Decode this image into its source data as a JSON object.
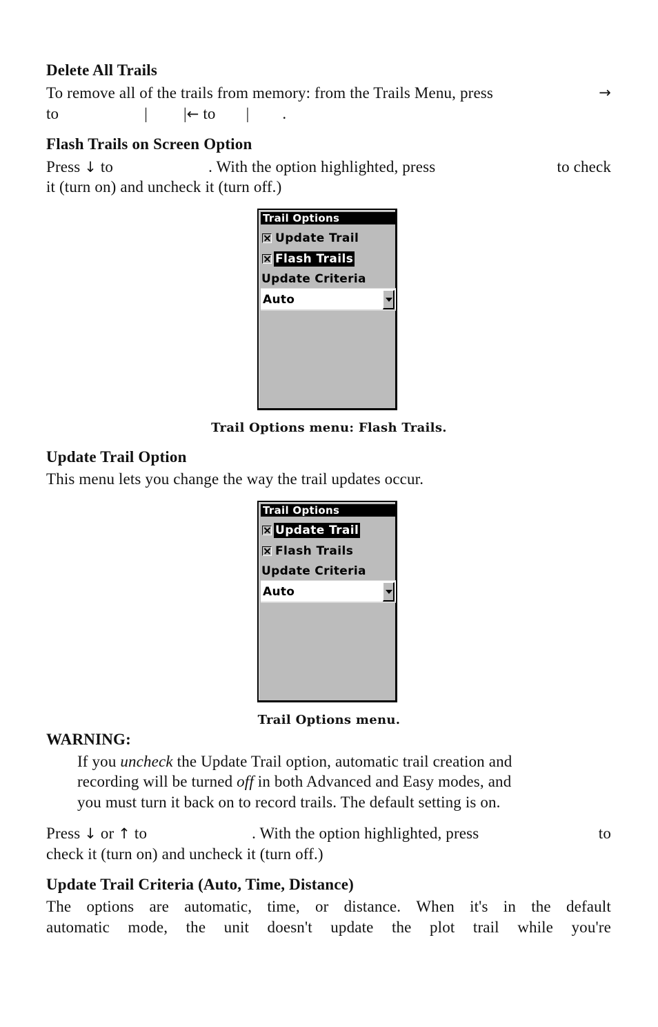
{
  "sections": {
    "delete_all": {
      "heading": "Delete All Trails",
      "line1": "To remove all of the trails from memory: from the Trails Menu, press",
      "line1_arrow": "→",
      "line2_a": "to",
      "line2_sep1": "|",
      "line2_sep2": "|",
      "line2_arrow": "←",
      "line2_b": "to",
      "line2_sep3": "|",
      "line2_end": "."
    },
    "flash_trails": {
      "heading": "Flash Trails on Screen Option",
      "line1_a": "Press",
      "line1_arrow": "↓",
      "line1_b": "to",
      "line1_c": ". With the option highlighted, press",
      "line1_d": "to check",
      "line2": "it (turn on) and uncheck it (turn off.)",
      "caption": "Trail Options menu: Flash Trails."
    },
    "update_trail": {
      "heading": "Update Trail Option",
      "line1": "This menu lets you change the way the trail updates occur.",
      "caption": "Trail Options menu."
    },
    "warning": {
      "label": "WARNING:",
      "line1_a": "If you",
      "line1_em": "uncheck",
      "line1_b": "the Update Trail option, automatic trail creation and",
      "line2_a": "recording will be turned",
      "line2_em": "off",
      "line2_b": "in both Advanced and Easy modes, and",
      "line3": "you must turn it back on to record trails. The default setting is on."
    },
    "press_update": {
      "line1_a": "Press",
      "line1_arrow1": "↓",
      "line1_or": "or",
      "line1_arrow2": "↑",
      "line1_b": "to",
      "line1_c": ". With the option highlighted, press",
      "line1_d": "to",
      "line2": "check it (turn on) and uncheck it (turn off.)"
    },
    "criteria": {
      "heading": "Update Trail Criteria (Auto, Time, Distance)",
      "line1_words": [
        "The",
        "options",
        "are",
        "automatic,",
        "time,",
        "or",
        "distance.",
        "When",
        "it's",
        "in",
        "the",
        "default"
      ],
      "line2_words": [
        "automatic",
        "mode,",
        "the",
        "unit",
        "doesn't",
        "update",
        "the",
        "plot",
        "trail",
        "while",
        "you're"
      ]
    }
  },
  "screens": [
    {
      "title": "Trail Options",
      "items": [
        {
          "label": "Update Trail",
          "checked": true,
          "highlighted": false
        },
        {
          "label": "Flash Trails",
          "checked": true,
          "highlighted": true
        }
      ],
      "criteria_label": "Update Criteria",
      "dropdown_value": "Auto"
    },
    {
      "title": "Trail Options",
      "items": [
        {
          "label": "Update Trail",
          "checked": true,
          "highlighted": true
        },
        {
          "label": "Flash Trails",
          "checked": true,
          "highlighted": false
        }
      ],
      "criteria_label": "Update Criteria",
      "dropdown_value": "Auto"
    }
  ]
}
